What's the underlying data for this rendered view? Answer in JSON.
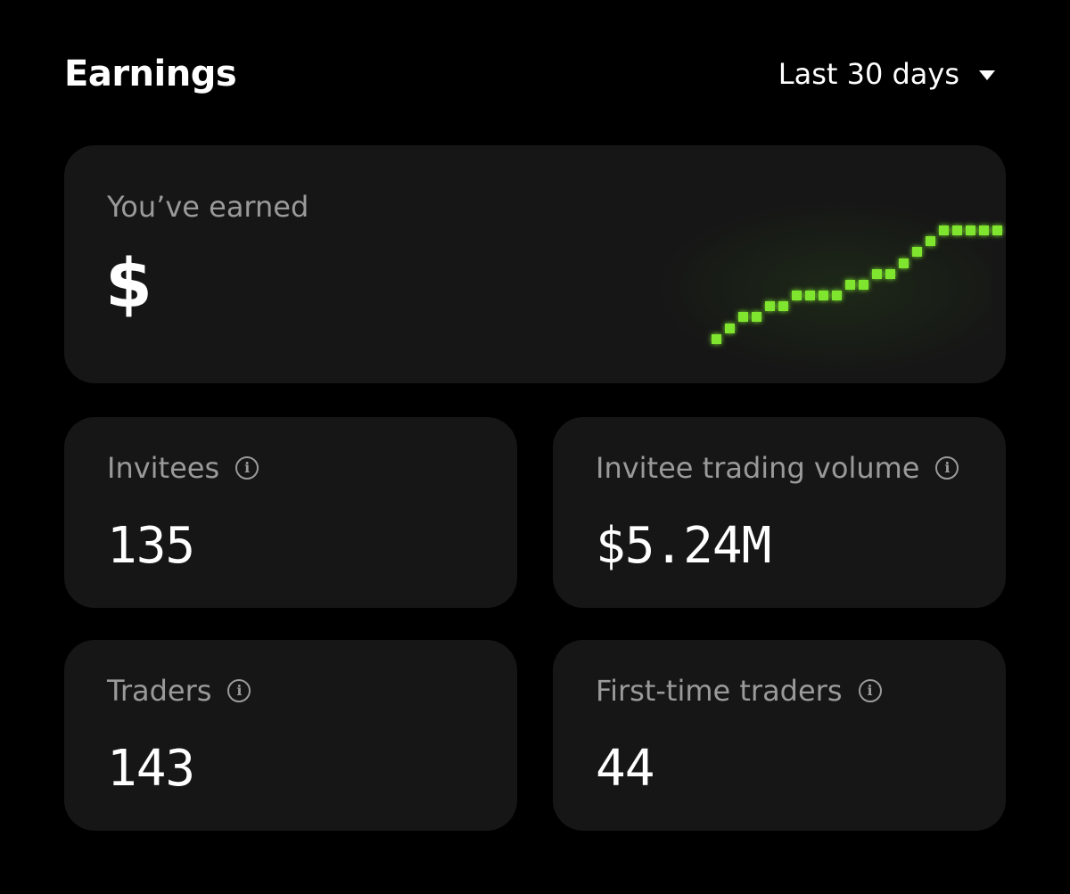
{
  "header": {
    "title": "Earnings",
    "range_label": "Last 30 days"
  },
  "earned": {
    "label": "You’ve earned",
    "value": "$"
  },
  "colors": {
    "background": "#000000",
    "card": "#161616",
    "muted_text": "#9a9a9a",
    "sparkline": "#7fe52e"
  },
  "stats": [
    {
      "label": "Invitees",
      "value": "135",
      "icon": "info-icon"
    },
    {
      "label": "Invitee trading volume",
      "value": "$5.24M",
      "icon": "info-icon"
    },
    {
      "label": "Traders",
      "value": "143",
      "icon": "info-icon"
    },
    {
      "label": "First-time traders",
      "value": "44",
      "icon": "info-icon"
    }
  ]
}
